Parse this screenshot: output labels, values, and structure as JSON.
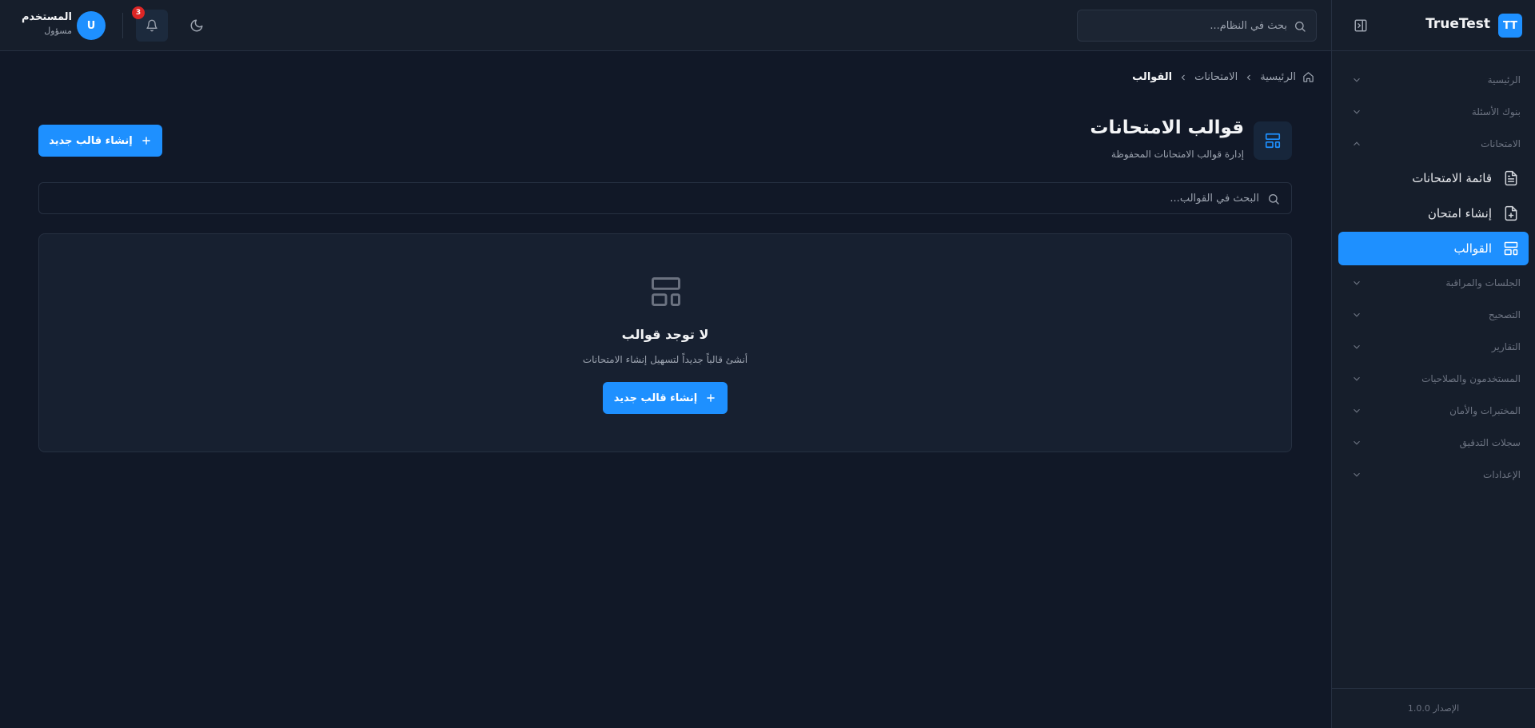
{
  "app": {
    "logo_text": "TT",
    "brand_name": "TrueTest",
    "version_label": "الإصدار 1.0.0"
  },
  "topbar": {
    "search_placeholder": "بحث في النظام...",
    "notifications_count": "3",
    "user": {
      "initial": "U",
      "name": "المستخدم",
      "role": "مسؤول"
    }
  },
  "sidebar": {
    "groups": [
      {
        "label": "الرئيسية",
        "expanded": false
      },
      {
        "label": "بنوك الأسئلة",
        "expanded": false
      },
      {
        "label": "الامتحانات",
        "expanded": true,
        "items": [
          {
            "label": "قائمة الامتحانات",
            "icon": "file-text-icon",
            "active": false
          },
          {
            "label": "إنشاء امتحان",
            "icon": "file-plus-icon",
            "active": false
          },
          {
            "label": "القوالب",
            "icon": "layout-template-icon",
            "active": true
          }
        ]
      },
      {
        "label": "الجلسات والمراقبة",
        "expanded": false
      },
      {
        "label": "التصحيح",
        "expanded": false
      },
      {
        "label": "التقارير",
        "expanded": false
      },
      {
        "label": "المستخدمون والصلاحيات",
        "expanded": false
      },
      {
        "label": "المختبرات والأمان",
        "expanded": false
      },
      {
        "label": "سجلات التدقيق",
        "expanded": false
      },
      {
        "label": "الإعدادات",
        "expanded": false
      }
    ]
  },
  "breadcrumb": {
    "home": "الرئيسية",
    "parent": "الامتحانات",
    "current": "القوالب"
  },
  "page": {
    "title": "قوالب الامتحانات",
    "subtitle": "إدارة قوالب الامتحانات المحفوظة",
    "create_button": "إنشاء قالب جديد",
    "search_placeholder": "البحث في القوالب..."
  },
  "empty_state": {
    "title": "لا توجد قوالب",
    "description": "أنشئ قالباً جديداً لتسهيل إنشاء الامتحانات",
    "button": "إنشاء قالب جديد"
  },
  "colors": {
    "accent": "#1e90ff",
    "background": "#111827",
    "panel": "#161e2b",
    "badge": "#dc2626"
  }
}
